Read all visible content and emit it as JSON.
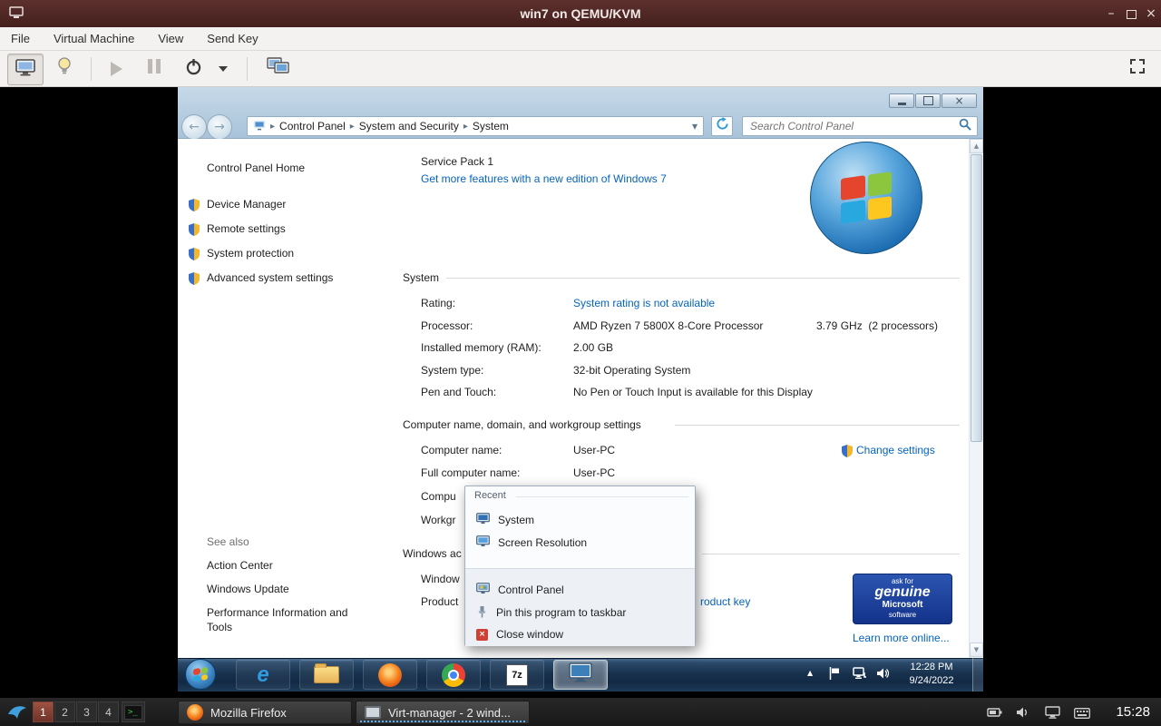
{
  "host": {
    "titlebar": {
      "title": "win7 on QEMU/KVM"
    },
    "menubar": {
      "items": [
        "File",
        "Virtual Machine",
        "View",
        "Send Key"
      ]
    },
    "taskbar": {
      "workspaces": [
        "1",
        "2",
        "3",
        "4"
      ],
      "window_buttons": [
        {
          "label": "Mozilla Firefox"
        },
        {
          "label": "Virt-manager - 2 wind..."
        }
      ],
      "clock": "15:28"
    }
  },
  "vm": {
    "nav": {
      "breadcrumb": [
        "Control Panel",
        "System and Security",
        "System"
      ],
      "search_placeholder": "Search Control Panel"
    },
    "sidebar": {
      "home": "Control Panel Home",
      "items": [
        "Device Manager",
        "Remote settings",
        "System protection",
        "Advanced system settings"
      ],
      "see_also": "See also",
      "see_also_items": [
        "Action Center",
        "Windows Update",
        "Performance Information and Tools"
      ]
    },
    "content": {
      "service_pack": "Service Pack 1",
      "upgrade_link": "Get more features with a new edition of Windows 7",
      "system_section_title": "System",
      "system_rows": [
        {
          "label": "Rating:",
          "value": "System rating is not available"
        },
        {
          "label": "Processor:",
          "value": "AMD Ryzen 7 5800X 8-Core Processor",
          "extra": "3.79 GHz  (2 processors)"
        },
        {
          "label": "Installed memory (RAM):",
          "value": "2.00 GB"
        },
        {
          "label": "System type:",
          "value": "32-bit Operating System"
        },
        {
          "label": "Pen and Touch:",
          "value": "No Pen or Touch Input is available for this Display"
        }
      ],
      "computer_section_title": "Computer name, domain, and workgroup settings",
      "change_settings": "Change settings",
      "computer_rows": [
        {
          "label": "Computer name:",
          "value": "User-PC"
        },
        {
          "label": "Full computer name:",
          "value": "User-PC"
        },
        {
          "label": "Compu",
          "value": ""
        },
        {
          "label": "Workgr",
          "value": ""
        }
      ],
      "activation_title_fragment": "Windows ac",
      "activation_row1_fragment": "Window",
      "activation_row2_fragment": "Product",
      "activation_right_fragment": "roduct key",
      "genuine_badge": {
        "line1": "ask for",
        "line2": "genuine",
        "line3": "Microsoft",
        "line4": "software"
      },
      "learn_more": "Learn more online..."
    },
    "jumplist": {
      "header": "Recent",
      "recent": [
        "System",
        "Screen Resolution"
      ],
      "commands": [
        "Control Panel",
        "Pin this program to taskbar",
        "Close window"
      ]
    },
    "taskbar": {
      "clock_time": "12:28 PM",
      "clock_date": "9/24/2022"
    }
  },
  "icons": {
    "breadcrumb_sep": "▸",
    "dropdown_caret": "▾",
    "tray_expand": "▲",
    "back_arrow": "←",
    "forward_arrow": "→",
    "scroll_up": "▲",
    "scroll_down": "▼",
    "minimize_glyph": "–",
    "close_glyph": "×",
    "ie_label": "e",
    "sevenzip_label": "7z"
  }
}
